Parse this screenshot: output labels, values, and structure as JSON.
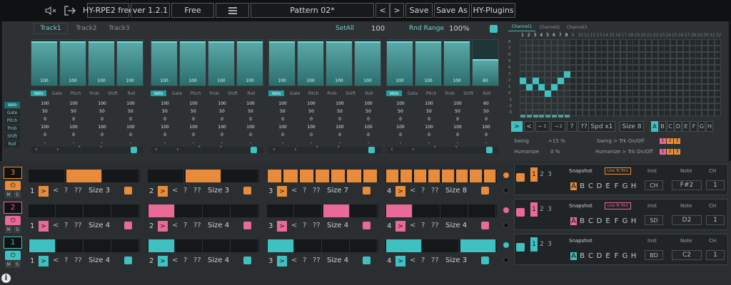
{
  "topbar": {
    "mute_icon": "speaker-mute-icon",
    "exit_icon": "exit-icon",
    "app": "HY-RPE2 free",
    "version": "ver 1.2.1",
    "edition": "Free",
    "menu_icon": "hamburger-menu-icon",
    "pattern": "Pattern 02*",
    "prev": "<",
    "next": ">",
    "save": "Save",
    "saveas": "Save As",
    "plugins": "HY-Plugins"
  },
  "tracks_tabs": [
    "Track1",
    "Track2",
    "Track3"
  ],
  "setall": "SetAll",
  "setall_value": "100",
  "rnd_label": "Rnd Range",
  "rnd_value": "100%",
  "channel_tabs": [
    "Channel1",
    "Channel2",
    "Channel3"
  ],
  "param_tabs": [
    "Velo",
    "Gate",
    "Pitch",
    "Prob",
    "Shift",
    "Roll"
  ],
  "row_labels": [
    "Velo",
    "Gate",
    "Pitch",
    "Prob",
    "Shift",
    "Roll"
  ],
  "groups": [
    {
      "faders": [
        100,
        100,
        100,
        100
      ],
      "rows": [
        [
          "100",
          "100",
          "100",
          "100"
        ],
        [
          "50",
          "50",
          "50",
          "50"
        ],
        [
          "0",
          "0",
          "0",
          "0"
        ],
        [
          "100",
          "100",
          "100",
          "100"
        ],
        [
          "0",
          "0",
          "0",
          "0"
        ],
        [
          "-",
          "-",
          "-",
          "-"
        ]
      ]
    },
    {
      "faders": [
        100,
        100,
        100,
        100
      ],
      "rows": [
        [
          "100",
          "100",
          "100",
          "100"
        ],
        [
          "50",
          "50",
          "50",
          "50"
        ],
        [
          "0",
          "0",
          "0",
          "0"
        ],
        [
          "100",
          "100",
          "100",
          "100"
        ],
        [
          "0",
          "0",
          "0",
          "0"
        ],
        [
          "-",
          "-",
          "-",
          "-"
        ]
      ]
    },
    {
      "faders": [
        100,
        100,
        100,
        100
      ],
      "rows": [
        [
          "100",
          "100",
          "100",
          "100"
        ],
        [
          "50",
          "50",
          "50",
          "50"
        ],
        [
          "0",
          "0",
          "0",
          "0"
        ],
        [
          "100",
          "100",
          "100",
          "100"
        ],
        [
          "0",
          "0",
          "0",
          "0"
        ],
        [
          "-",
          "-",
          "-",
          "-"
        ]
      ]
    },
    {
      "faders": [
        100,
        100,
        100,
        60
      ],
      "rows": [
        [
          "100",
          "100",
          "100",
          "60"
        ],
        [
          "50",
          "50",
          "50",
          "50"
        ],
        [
          "0",
          "0",
          "0",
          "0"
        ],
        [
          "100",
          "100",
          "100",
          "100"
        ],
        [
          "0",
          "0",
          "0",
          "0"
        ],
        [
          "-",
          "-",
          "-",
          "-"
        ]
      ]
    }
  ],
  "grid_cols": [
    "1",
    "2",
    "3",
    "4",
    "5",
    "6",
    "7",
    "8",
    "9",
    "10",
    "11",
    "12",
    "13",
    "14",
    "15",
    "16",
    "17",
    "18",
    "19",
    "20",
    "21",
    "22",
    "23",
    "24",
    "25",
    "26",
    "27",
    "28",
    "29",
    "30",
    "31",
    "32"
  ],
  "grid_rows": [
    "8",
    "7",
    "6",
    "5",
    "4",
    "3",
    "2",
    "1",
    "0",
    "-1",
    "-2",
    "-3"
  ],
  "grid_notes": [
    [
      1,
      2
    ],
    [
      2,
      1
    ],
    [
      3,
      2
    ],
    [
      4,
      1
    ],
    [
      5,
      0
    ],
    [
      6,
      1
    ],
    [
      7,
      2
    ],
    [
      8,
      3
    ]
  ],
  "step_ctrl": {
    "play": ">",
    "prev": "<",
    "b1": "← 1",
    "b2": "→ 2",
    "q1": "?",
    "q2": "??",
    "speed": "Spd x1",
    "size": "Size 8",
    "letters": [
      "A",
      "B",
      "C",
      "D",
      "E",
      "F",
      "G",
      "H"
    ]
  },
  "swing": {
    "label": "Swing",
    "value": "+15 %",
    "trk": "Swing > Trk On/Off",
    "nums": [
      "1",
      "2",
      "3"
    ]
  },
  "humanize": {
    "label": "Humanize",
    "value": "0 %",
    "trk": "Humanize > Trk On/Off",
    "nums": [
      "1",
      "2",
      "3"
    ]
  },
  "seq_rows": [
    {
      "num": "3",
      "color": "#e88b3a",
      "cls": "or",
      "mute": "M",
      "solo": "S",
      "ctrl": {
        "q1": "?",
        "q2": "??"
      },
      "blocks": [
        {
          "idx": "1",
          "size": "Size 3"
        },
        {
          "idx": "2",
          "size": "Size 3"
        },
        {
          "idx": "3",
          "size": "Size 7"
        },
        {
          "idx": "4",
          "size": "Size 8"
        }
      ],
      "snapshot": "Snapshot",
      "live": "Live To Trk1",
      "letters": [
        "A",
        "B",
        "C",
        "D",
        "E",
        "F",
        "G",
        "H"
      ],
      "slots": [
        "1",
        "2",
        "3"
      ],
      "inst_label": "Inst",
      "inst": "CH",
      "note_label": "Note",
      "note": "F#2",
      "ch_label": "CH",
      "ch": "1"
    },
    {
      "num": "2",
      "color": "#e86a95",
      "cls": "pk",
      "mute": "M",
      "solo": "S",
      "ctrl": {
        "q1": "?",
        "q2": "??"
      },
      "blocks": [
        {
          "idx": "1",
          "size": "Size 4"
        },
        {
          "idx": "2",
          "size": "Size 4"
        },
        {
          "idx": "3",
          "size": "Size 4"
        },
        {
          "idx": "4",
          "size": "Size 4"
        }
      ],
      "snapshot": "Snapshot",
      "live": "Live To Trk1",
      "letters": [
        "A",
        "B",
        "C",
        "D",
        "E",
        "F",
        "G",
        "H"
      ],
      "slots": [
        "1",
        "2",
        "3"
      ],
      "inst_label": "Inst",
      "inst": "SD",
      "note_label": "Note",
      "note": "D2",
      "ch_label": "CH",
      "ch": "1"
    },
    {
      "num": "1",
      "color": "#3fc1c2",
      "cls": "cy",
      "mute": "M",
      "solo": "S",
      "ctrl": {
        "q1": "?",
        "q2": "??"
      },
      "blocks": [
        {
          "idx": "1",
          "size": "Size 4"
        },
        {
          "idx": "2",
          "size": "Size 4"
        },
        {
          "idx": "3",
          "size": "Size 4"
        },
        {
          "idx": "4",
          "size": "Size 3"
        }
      ],
      "snapshot": "Snapshot",
      "live": "",
      "letters": [
        "A",
        "B",
        "C",
        "D",
        "E",
        "F",
        "G",
        "H"
      ],
      "slots": [
        "1",
        "2",
        "3"
      ],
      "inst_label": "Inst",
      "inst": "BD",
      "note_label": "Note",
      "note": "C2",
      "ch_label": "CH",
      "ch": "1"
    }
  ],
  "info_icon": "info-icon"
}
